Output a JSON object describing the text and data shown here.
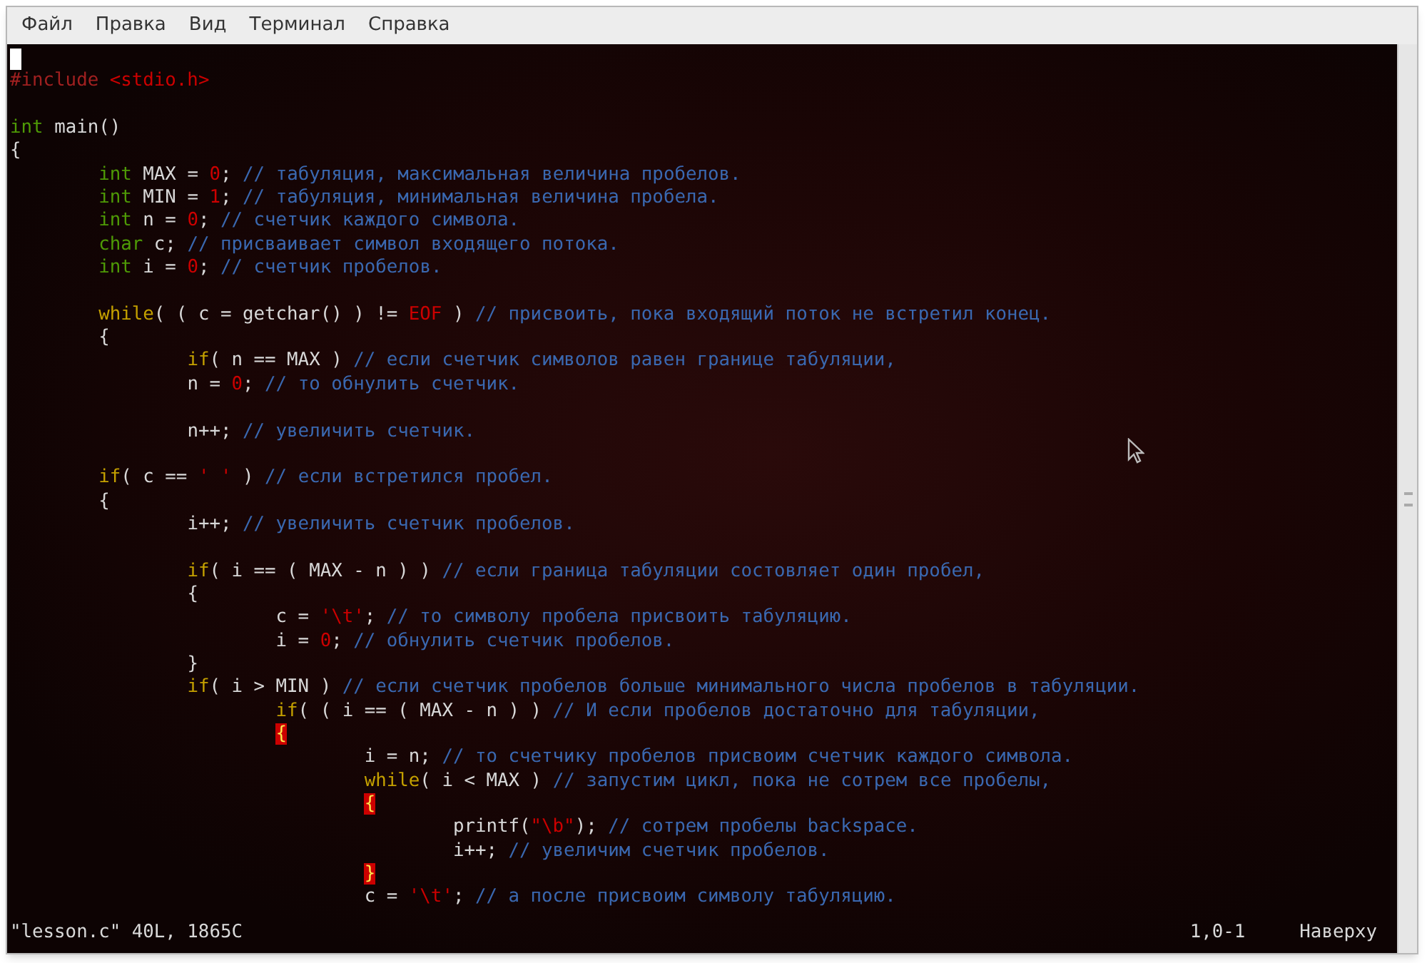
{
  "menu": [
    "Файл",
    "Правка",
    "Вид",
    "Терминал",
    "Справка"
  ],
  "editor": {
    "cursor_shown": true,
    "lines": [
      {
        "kind": "code",
        "tokens": [
          {
            "kind": "pre",
            "text": "#include"
          },
          {
            "kind": "str",
            "text": " <stdio.h>"
          }
        ]
      },
      {
        "kind": "blank"
      },
      {
        "kind": "code",
        "tokens": [
          {
            "kind": "type",
            "text": "int"
          },
          {
            "kind": "plain",
            "text": " main()"
          }
        ]
      },
      {
        "kind": "code",
        "tokens": [
          {
            "kind": "plain",
            "text": "{"
          }
        ]
      },
      {
        "kind": "code",
        "tokens": [
          {
            "kind": "type",
            "text": "\tint"
          },
          {
            "kind": "plain",
            "text": " MAX = "
          },
          {
            "kind": "num",
            "text": "0"
          },
          {
            "kind": "plain",
            "text": "; "
          },
          {
            "kind": "comment",
            "text": "// табуляция, максимальная величина пробелов."
          }
        ]
      },
      {
        "kind": "code",
        "tokens": [
          {
            "kind": "type",
            "text": "\tint"
          },
          {
            "kind": "plain",
            "text": " MIN = "
          },
          {
            "kind": "num",
            "text": "1"
          },
          {
            "kind": "plain",
            "text": "; "
          },
          {
            "kind": "comment",
            "text": "// табуляция, минимальная величина пробела."
          }
        ]
      },
      {
        "kind": "code",
        "tokens": [
          {
            "kind": "type",
            "text": "\tint"
          },
          {
            "kind": "plain",
            "text": " n = "
          },
          {
            "kind": "num",
            "text": "0"
          },
          {
            "kind": "plain",
            "text": "; "
          },
          {
            "kind": "comment",
            "text": "// счетчик каждого символа."
          }
        ]
      },
      {
        "kind": "code",
        "tokens": [
          {
            "kind": "type",
            "text": "\tchar"
          },
          {
            "kind": "plain",
            "text": " c; "
          },
          {
            "kind": "comment",
            "text": "// присваивает символ входящего потока."
          }
        ]
      },
      {
        "kind": "code",
        "tokens": [
          {
            "kind": "type",
            "text": "\tint"
          },
          {
            "kind": "plain",
            "text": " i = "
          },
          {
            "kind": "num",
            "text": "0"
          },
          {
            "kind": "plain",
            "text": "; "
          },
          {
            "kind": "comment",
            "text": "// счетчик пробелов."
          }
        ]
      },
      {
        "kind": "blank"
      },
      {
        "kind": "code",
        "tokens": [
          {
            "kind": "stmt",
            "text": "\twhile"
          },
          {
            "kind": "plain",
            "text": "( ( c = getchar() ) != "
          },
          {
            "kind": "num",
            "text": "EOF"
          },
          {
            "kind": "plain",
            "text": " ) "
          },
          {
            "kind": "comment",
            "text": "// присвоить, пока входящий поток не встретил конец."
          }
        ]
      },
      {
        "kind": "code",
        "tokens": [
          {
            "kind": "plain",
            "text": "\t{"
          }
        ]
      },
      {
        "kind": "code",
        "tokens": [
          {
            "kind": "stmt",
            "text": "\t\tif"
          },
          {
            "kind": "plain",
            "text": "( n == MAX ) "
          },
          {
            "kind": "comment",
            "text": "// если счетчик символов равен границе табуляции,"
          }
        ]
      },
      {
        "kind": "code",
        "tokens": [
          {
            "kind": "plain",
            "text": "\t\tn = "
          },
          {
            "kind": "num",
            "text": "0"
          },
          {
            "kind": "plain",
            "text": "; "
          },
          {
            "kind": "comment",
            "text": "// то обнулить счетчик."
          }
        ]
      },
      {
        "kind": "blank"
      },
      {
        "kind": "code",
        "tokens": [
          {
            "kind": "plain",
            "text": "\t\tn++; "
          },
          {
            "kind": "comment",
            "text": "// увеличить счетчик."
          }
        ]
      },
      {
        "kind": "blank"
      },
      {
        "kind": "code",
        "tokens": [
          {
            "kind": "stmt",
            "text": "\tif"
          },
          {
            "kind": "plain",
            "text": "( c == "
          },
          {
            "kind": "str",
            "text": "' '"
          },
          {
            "kind": "plain",
            "text": " ) "
          },
          {
            "kind": "comment",
            "text": "// если встретился пробел."
          }
        ]
      },
      {
        "kind": "code",
        "tokens": [
          {
            "kind": "plain",
            "text": "\t{"
          }
        ]
      },
      {
        "kind": "code",
        "tokens": [
          {
            "kind": "plain",
            "text": "\t\ti++; "
          },
          {
            "kind": "comment",
            "text": "// увеличить счетчик пробелов."
          }
        ]
      },
      {
        "kind": "blank"
      },
      {
        "kind": "code",
        "tokens": [
          {
            "kind": "stmt",
            "text": "\t\tif"
          },
          {
            "kind": "plain",
            "text": "( i == ( MAX - n ) ) "
          },
          {
            "kind": "comment",
            "text": "// если граница табуляции состовляет один пробел,"
          }
        ]
      },
      {
        "kind": "code",
        "tokens": [
          {
            "kind": "plain",
            "text": "\t\t{"
          }
        ]
      },
      {
        "kind": "code",
        "tokens": [
          {
            "kind": "plain",
            "text": "\t\t\tc = "
          },
          {
            "kind": "str",
            "text": "'\\t'"
          },
          {
            "kind": "plain",
            "text": "; "
          },
          {
            "kind": "comment",
            "text": "// то символу пробела присвоить табуляцию."
          }
        ]
      },
      {
        "kind": "code",
        "tokens": [
          {
            "kind": "plain",
            "text": "\t\t\ti = "
          },
          {
            "kind": "num",
            "text": "0"
          },
          {
            "kind": "plain",
            "text": "; "
          },
          {
            "kind": "comment",
            "text": "// обнулить счетчик пробелов."
          }
        ]
      },
      {
        "kind": "code",
        "tokens": [
          {
            "kind": "plain",
            "text": "\t\t}"
          }
        ]
      },
      {
        "kind": "code",
        "tokens": [
          {
            "kind": "stmt",
            "text": "\t\tif"
          },
          {
            "kind": "plain",
            "text": "( i > MIN ) "
          },
          {
            "kind": "comment",
            "text": "// если счетчик пробелов больше минимального числа пробелов в табуляции."
          }
        ]
      },
      {
        "kind": "code",
        "tokens": [
          {
            "kind": "stmt",
            "text": "\t\t\tif"
          },
          {
            "kind": "plain",
            "text": "( ( i == ( MAX - n ) ) "
          },
          {
            "kind": "comment",
            "text": "// И если пробелов достаточно для табуляции,"
          }
        ]
      },
      {
        "kind": "code",
        "tokens": [
          {
            "kind": "match",
            "text": "\t\t\t{"
          }
        ]
      },
      {
        "kind": "code",
        "tokens": [
          {
            "kind": "plain",
            "text": "\t\t\t\ti = n; "
          },
          {
            "kind": "comment",
            "text": "// то счетчику пробелов присвоим счетчик каждого символа."
          }
        ]
      },
      {
        "kind": "code",
        "tokens": [
          {
            "kind": "stmt",
            "text": "\t\t\t\twhile"
          },
          {
            "kind": "plain",
            "text": "( i < MAX ) "
          },
          {
            "kind": "comment",
            "text": "// запустим цикл, пока не сотрем все пробелы,"
          }
        ]
      },
      {
        "kind": "code",
        "tokens": [
          {
            "kind": "match",
            "text": "\t\t\t\t{"
          }
        ]
      },
      {
        "kind": "code",
        "tokens": [
          {
            "kind": "plain",
            "text": "\t\t\t\t\tprintf("
          },
          {
            "kind": "str",
            "text": "\"\\b\""
          },
          {
            "kind": "plain",
            "text": "); "
          },
          {
            "kind": "comment",
            "text": "// сотрем пробелы backspace."
          }
        ]
      },
      {
        "kind": "code",
        "tokens": [
          {
            "kind": "plain",
            "text": "\t\t\t\t\ti++; "
          },
          {
            "kind": "comment",
            "text": "// увеличим счетчик пробелов."
          }
        ]
      },
      {
        "kind": "code",
        "tokens": [
          {
            "kind": "match",
            "text": "\t\t\t\t}"
          }
        ]
      },
      {
        "kind": "code",
        "tokens": [
          {
            "kind": "plain",
            "text": "\t\t\t\tc = "
          },
          {
            "kind": "str",
            "text": "'\\t'"
          },
          {
            "kind": "plain",
            "text": "; "
          },
          {
            "kind": "comment",
            "text": "// а после присвоим символу табуляцию."
          }
        ]
      }
    ]
  },
  "status_bar": {
    "file_info": "\"lesson.c\" 40L, 1865C",
    "position": "1,0-1",
    "scroll": "Наверху"
  }
}
